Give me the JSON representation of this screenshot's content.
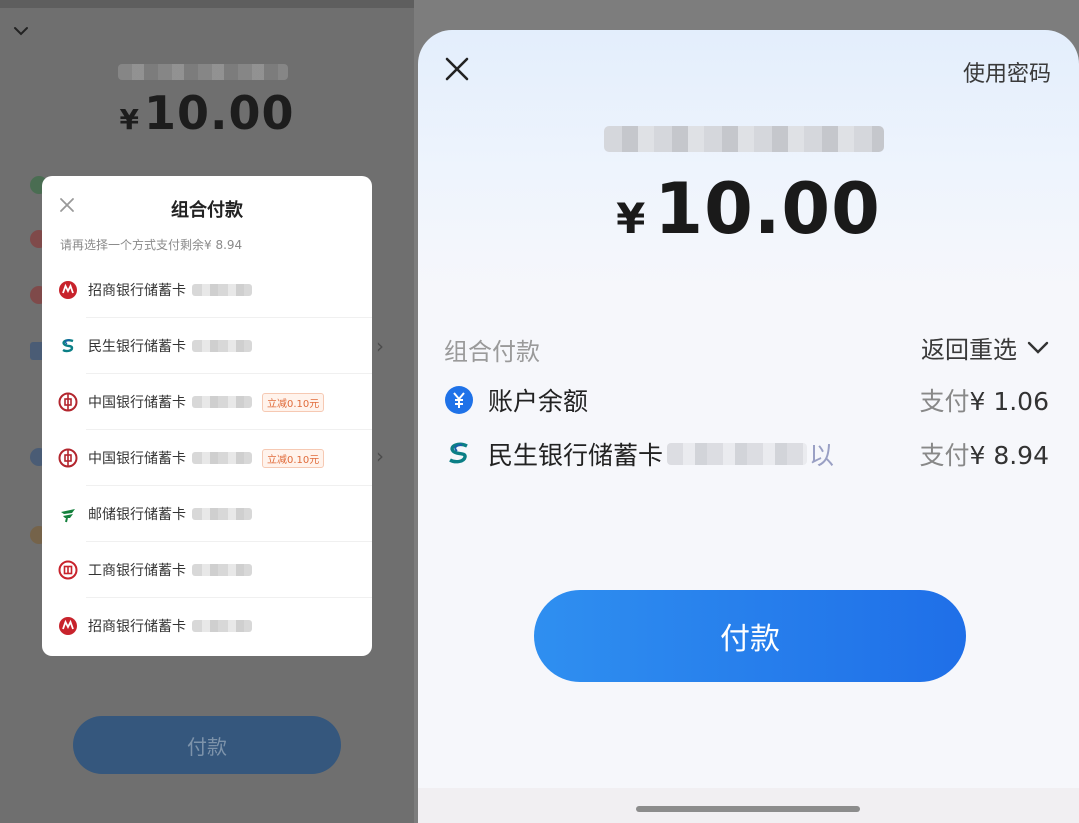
{
  "left": {
    "amount": "10.00",
    "currency": "¥",
    "pay_button": "付款",
    "modal": {
      "title": "组合付款",
      "hint": "请再选择一个方式支付剩余¥ 8.94",
      "banks": [
        {
          "name": "招商银行储蓄卡",
          "logo": "cmb-logo-icon",
          "promo": ""
        },
        {
          "name": "民生银行储蓄卡",
          "logo": "cmbc-logo-icon",
          "promo": ""
        },
        {
          "name": "中国银行储蓄卡",
          "logo": "boc-logo-icon",
          "promo": "立减0.10元"
        },
        {
          "name": "中国银行储蓄卡",
          "logo": "boc-logo-icon",
          "promo": "立减0.10元"
        },
        {
          "name": "邮储银行储蓄卡",
          "logo": "psbc-logo-icon",
          "promo": ""
        },
        {
          "name": "工商银行储蓄卡",
          "logo": "icbc-logo-icon",
          "promo": ""
        },
        {
          "name": "招商银行储蓄卡",
          "logo": "cmb-logo-icon",
          "promo": ""
        }
      ]
    }
  },
  "right": {
    "use_password": "使用密码",
    "currency": "¥",
    "amount": "10.00",
    "combo_label": "组合付款",
    "reselect": "返回重选",
    "payments": [
      {
        "name": "账户余额",
        "suffix": "",
        "label": "支付",
        "amount": "¥ 1.06",
        "logo": "balance-yen-icon"
      },
      {
        "name": "民生银行储蓄卡",
        "suffix": "以",
        "label": "支付",
        "amount": "¥ 8.94",
        "logo": "cmbc-logo-icon"
      }
    ],
    "pay_button": "付款"
  },
  "colors": {
    "accent_blue": "#1f6fe8",
    "promo_orange": "#e06b3a",
    "cmb_red": "#c8232c",
    "cmbc_teal": "#0b7f86",
    "psbc_green": "#14803c"
  }
}
